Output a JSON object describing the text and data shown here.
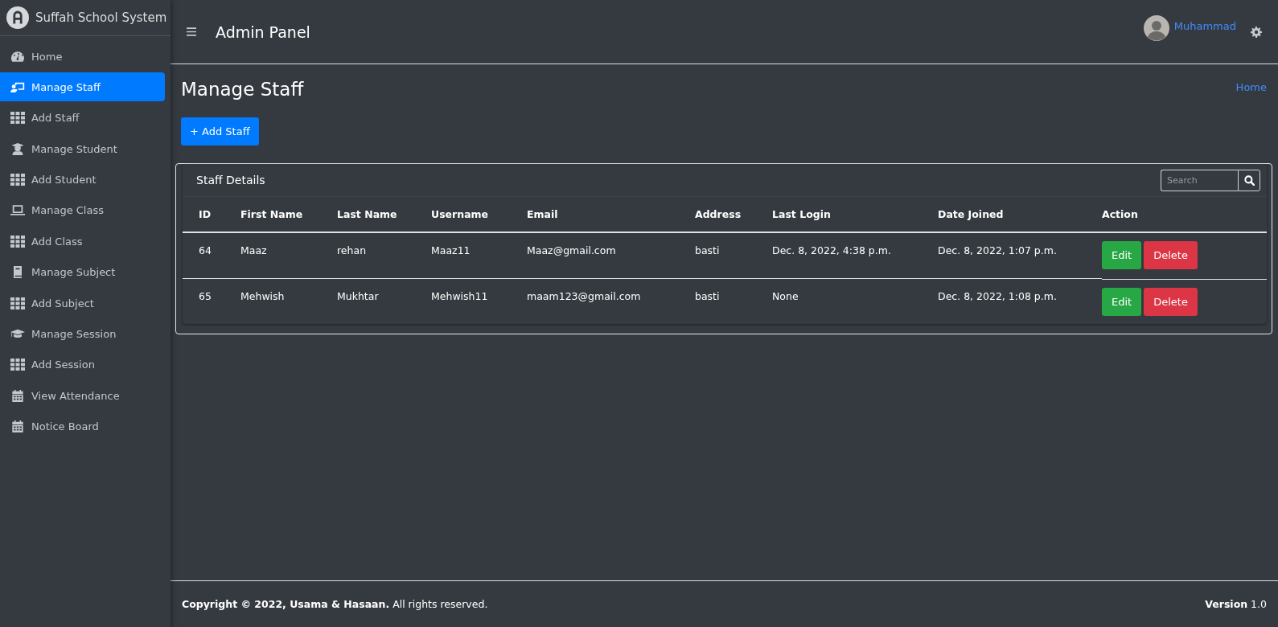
{
  "brand": {
    "title": "Suffah School System"
  },
  "sidebar": {
    "items": [
      {
        "label": "Home",
        "selected": false
      },
      {
        "label": "Manage Staff",
        "selected": true
      },
      {
        "label": "Add Staff",
        "selected": false
      },
      {
        "label": "Manage Student",
        "selected": false
      },
      {
        "label": "Add Student",
        "selected": false
      },
      {
        "label": "Manage Class",
        "selected": false
      },
      {
        "label": "Add Class",
        "selected": false
      },
      {
        "label": "Manage Subject",
        "selected": false
      },
      {
        "label": "Add Subject",
        "selected": false
      },
      {
        "label": "Manage Session",
        "selected": false
      },
      {
        "label": "Add Session",
        "selected": false
      },
      {
        "label": "View Attendance",
        "selected": false
      },
      {
        "label": "Notice Board",
        "selected": false
      }
    ]
  },
  "header": {
    "title": "Admin Panel",
    "user": "Muhammad"
  },
  "page": {
    "title": "Manage Staff",
    "breadcrumb": "Home",
    "add_button": "+ Add Staff"
  },
  "card": {
    "title": "Staff Details",
    "search": {
      "placeholder": "Search"
    },
    "table": {
      "columns": [
        "ID",
        "First Name",
        "Last Name",
        "Username",
        "Email",
        "Address",
        "Last Login",
        "Date Joined",
        "Action"
      ],
      "rows": [
        {
          "cells": [
            "64",
            "Maaz",
            "rehan",
            "Maaz11",
            "Maaz@gmail.com",
            "basti",
            "Dec. 8, 2022, 4:38 p.m.",
            "Dec. 8, 2022, 1:07 p.m."
          ],
          "actions": [
            "Edit",
            "Delete"
          ]
        },
        {
          "cells": [
            "65",
            "Mehwish",
            "Mukhtar",
            "Mehwish11",
            "maam123@gmail.com",
            "basti",
            "None",
            "Dec. 8, 2022, 1:08 p.m."
          ],
          "actions": [
            "Edit",
            "Delete"
          ]
        }
      ]
    }
  },
  "footer": {
    "copyright": "**Copyright © 2022, Usama & Hasaan.** All rights reserved.",
    "version": "**Version** 1.0"
  }
}
